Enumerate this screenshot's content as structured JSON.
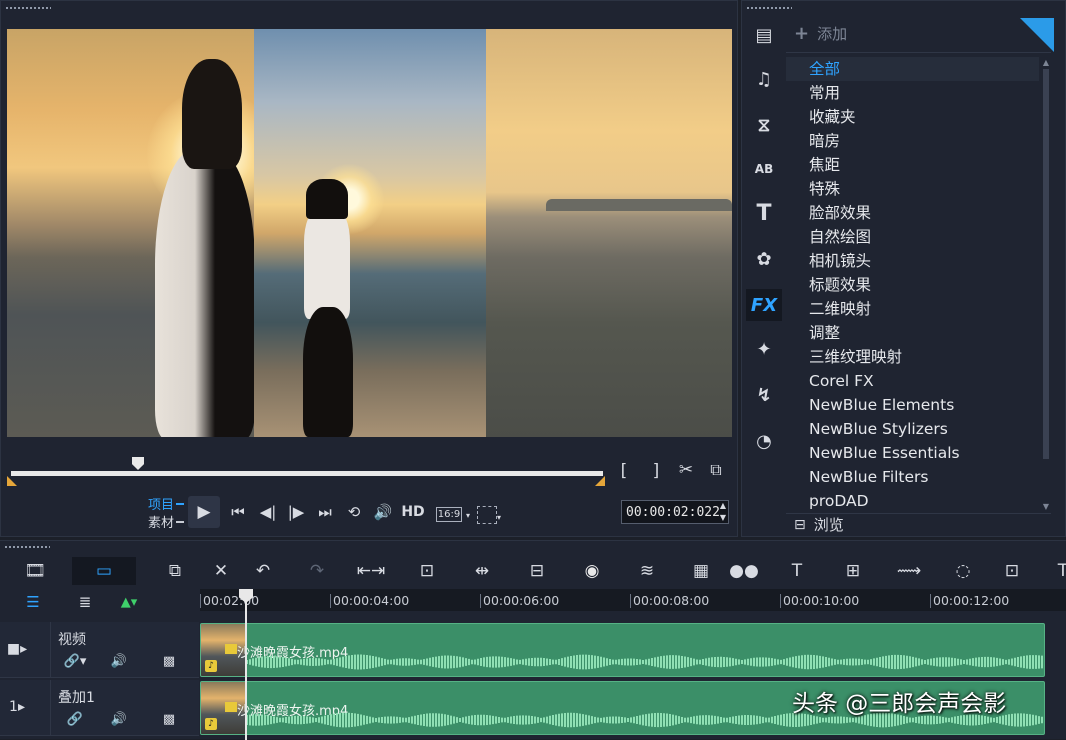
{
  "preview": {
    "mode_project": "项目",
    "mode_clip": "素材",
    "hd_label": "HD",
    "aspect_label": "16:9",
    "timecode": "00:00:02:022"
  },
  "library": {
    "add_label": "添加",
    "categories": [
      "全部",
      "常用",
      "收藏夹",
      "暗房",
      "焦距",
      "特殊",
      "脸部效果",
      "自然绘图",
      "相机镜头",
      "标题效果",
      "二维映射",
      "调整",
      "三维纹理映射",
      "Corel FX",
      "NewBlue Elements",
      "NewBlue Stylizers",
      "NewBlue Essentials",
      "NewBlue Filters",
      "proDAD"
    ],
    "selected_index": 0,
    "browse_label": "浏览",
    "tab_icons": [
      "media-icon",
      "audio-icon",
      "transition-icon",
      "title-template-icon",
      "text-icon",
      "graphics-icon",
      "fx-icon",
      "magic-wand-icon",
      "path-icon",
      "speedometer-icon"
    ],
    "active_tab": "fx-icon",
    "fx_tab_label": "FX"
  },
  "timeline": {
    "ruler": [
      "00:02:00",
      "00:00:04:00",
      "00:00:06:00",
      "00:00:08:00",
      "00:00:10:00",
      "00:00:12:00"
    ],
    "tracks": [
      {
        "name": "视频",
        "clip": "沙滩晚霞女孩.mp4"
      },
      {
        "name": "叠加1",
        "clip": "沙滩晚霞女孩.mp4"
      }
    ]
  },
  "watermark": "头条 @三郎会声会影",
  "colors": {
    "accent": "#2fa3ff",
    "clip": "#3b8f68",
    "panel": "#1f2431"
  }
}
